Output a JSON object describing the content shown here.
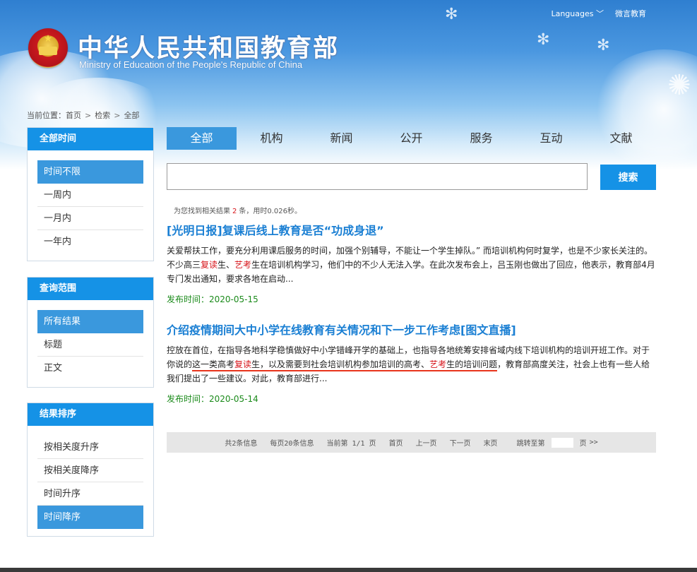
{
  "header": {
    "languages_label": "Languages",
    "weibo_label": "微言教育",
    "site_title": "中华人民共和国教育部",
    "site_subtitle": "Ministry of Education of the People's Republic of China"
  },
  "breadcrumb": {
    "prefix": "当前位置：",
    "items": [
      "首页",
      "检索",
      "全部"
    ],
    "separator": ">"
  },
  "sidebar": {
    "time": {
      "heading": "全部时间",
      "items": [
        "时间不限",
        "一周内",
        "一月内",
        "一年内"
      ],
      "active": "时间不限"
    },
    "scope": {
      "heading": "查询范围",
      "items": [
        "所有结果",
        "标题",
        "正文"
      ],
      "active": "所有结果"
    },
    "sort": {
      "heading": "结果排序",
      "items": [
        "按相关度升序",
        "按相关度降序",
        "时间升序",
        "时间降序"
      ],
      "active": "时间降序"
    }
  },
  "tabs": {
    "items": [
      "全部",
      "机构",
      "新闻",
      "公开",
      "服务",
      "互动",
      "文献"
    ],
    "active": "全部"
  },
  "search": {
    "value": "",
    "button_label": "搜索"
  },
  "summary": {
    "prefix": "为您找到相关结果",
    "count": "2",
    "suffix": "条，用时0.026秒。"
  },
  "results": [
    {
      "title": "[光明日报]复课后线上教育是否“功成身退”",
      "snippet_parts": [
        {
          "t": "关爱帮扶工作，要充分利用课后服务的时间，加强个别辅导，不能让一个学生掉队。”  而培训机构何时复学，也是不少家长关注的。不少高三",
          "s": "n"
        },
        {
          "t": "复读",
          "s": "hl"
        },
        {
          "t": "生、",
          "s": "n"
        },
        {
          "t": "艺考",
          "s": "hl"
        },
        {
          "t": "生在培训机构学习，他们中的不少人无法入学。在此次发布会上，吕玉刚也做出了回应，他表示，教育部4月专门发出通知，要求各地在启动...",
          "s": "n"
        }
      ],
      "date_label": "发布时间：",
      "date": "2020-05-15"
    },
    {
      "title": "介绍疫情期间大中小学在线教育有关情况和下一步工作考虑[图文直播]",
      "snippet_parts": [
        {
          "t": "控放在首位，在指导各地科学稳慎做好中小学错峰开学的基础上，也指导各地统筹安排省域内线下培训机构的培训开班工作。对于你说的",
          "s": "n"
        },
        {
          "t": "这一类高考",
          "s": "u"
        },
        {
          "t": "复读",
          "s": "uhl"
        },
        {
          "t": "生，以及需要到社会培训机构参加培训的高考、",
          "s": "u"
        },
        {
          "t": "艺考",
          "s": "uhl"
        },
        {
          "t": "生的培训问题",
          "s": "u"
        },
        {
          "t": "，教育部高度关注，社会上也有一些人给我们提出了一些建议。对此，教育部进行...",
          "s": "n"
        }
      ],
      "date_label": "发布时间：",
      "date": "2020-05-14"
    }
  ],
  "pager": {
    "total": "共2条信息",
    "per_page": "每页20条信息",
    "current": "当前第 1/1 页",
    "first": "首页",
    "prev": "上一页",
    "next": "下一页",
    "last": "末页",
    "jump_label": "跳转至第",
    "page_unit": "页",
    "go": ">>"
  },
  "colors": {
    "accent": "#1592e6",
    "active_item": "#3a98dd",
    "title_link": "#1a7fd3",
    "highlight": "#d7141a",
    "date_green": "#1a8a1a",
    "annotation_underline": "#e8341c"
  },
  "icons": {
    "languages": "chevron-down-icon",
    "emblem": "national-emblem-icon"
  }
}
